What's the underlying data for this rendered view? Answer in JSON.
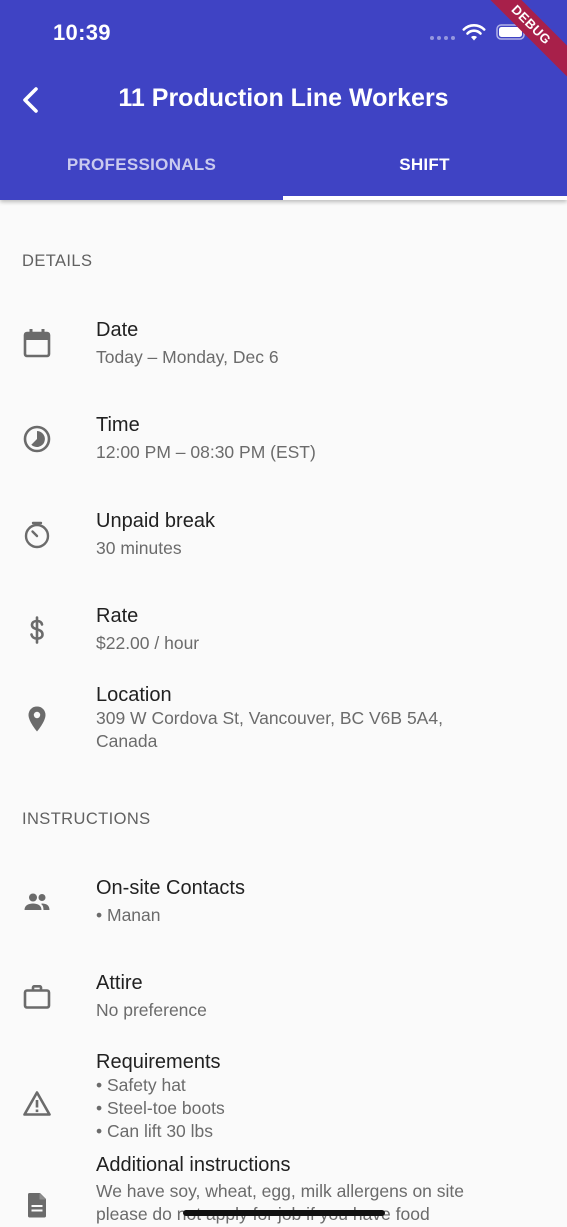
{
  "status_bar": {
    "time": "10:39"
  },
  "debug_banner": "DEBUG",
  "header": {
    "title": "11 Production Line Workers"
  },
  "tabs": [
    {
      "label": "PROFESSIONALS",
      "selected": false
    },
    {
      "label": "SHIFT",
      "selected": true
    }
  ],
  "details": {
    "header": "DETAILS",
    "date": {
      "title": "Date",
      "value": "Today – Monday, Dec 6",
      "icon": "calendar-icon"
    },
    "time": {
      "title": "Time",
      "value": "12:00 PM – 08:30 PM (EST)",
      "icon": "clock-icon"
    },
    "break": {
      "title": "Unpaid break",
      "value": "30 minutes",
      "icon": "timer-icon"
    },
    "rate": {
      "title": "Rate",
      "value": "$22.00 / hour",
      "icon": "dollar-icon"
    },
    "location": {
      "title": "Location",
      "line1": "309 W Cordova St, Vancouver, BC V6B 5A4,",
      "line2": "Canada",
      "icon": "location-pin-icon"
    }
  },
  "instructions": {
    "header": "INSTRUCTIONS",
    "contacts": {
      "title": "On-site Contacts",
      "items": [
        "• Manan"
      ],
      "icon": "people-icon"
    },
    "attire": {
      "title": "Attire",
      "value": "No preference",
      "icon": "briefcase-icon"
    },
    "requirements": {
      "title": "Requirements",
      "items": [
        "• Safety hat",
        "• Steel-toe boots",
        "• Can lift 30 lbs"
      ],
      "icon": "warning-icon"
    },
    "additional": {
      "title": "Additional instructions",
      "line1": "We have soy, wheat, egg, milk allergens on site",
      "line2": "please do not apply for job if you have food",
      "icon": "document-icon"
    }
  },
  "colors": {
    "appbar": "#3f43c4",
    "background": "#fafafa",
    "icon": "#6b6b6b"
  }
}
